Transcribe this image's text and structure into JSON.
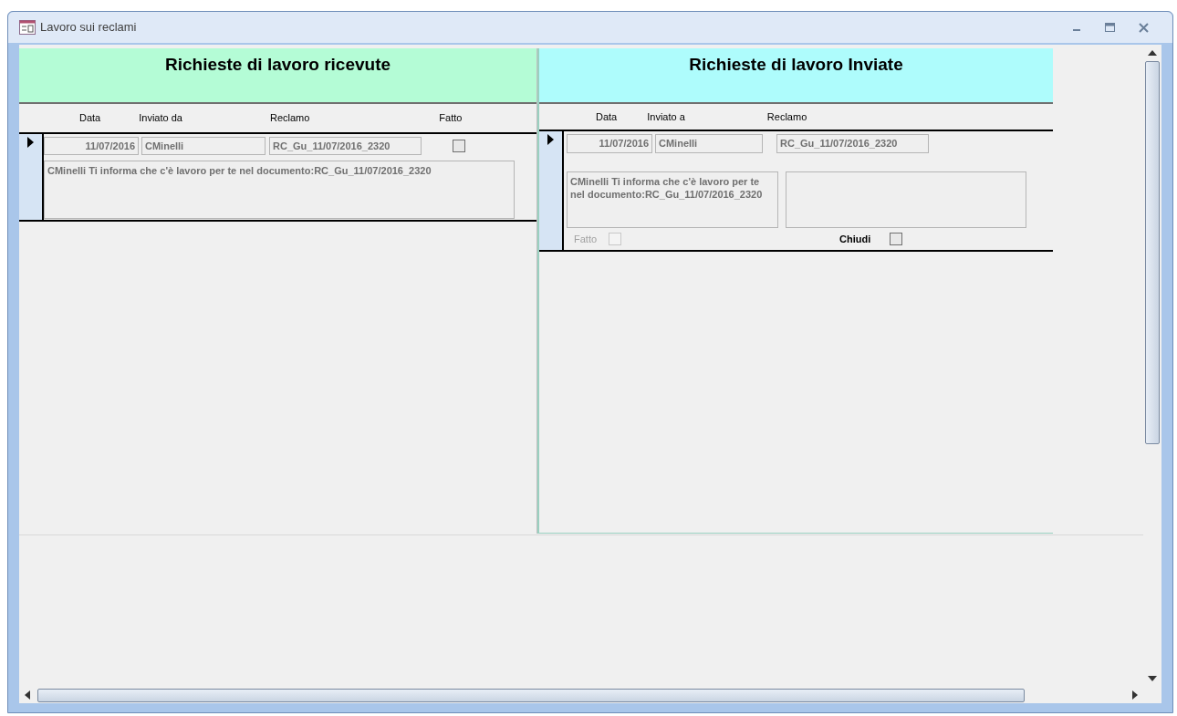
{
  "window": {
    "title": "Lavoro sui reclami"
  },
  "panels": [
    {
      "kind": "received",
      "title": "Richieste di lavoro ricevute",
      "color": "#b4fcd6",
      "columns": [
        "Data",
        "Inviato da",
        "Reclamo",
        "Fatto"
      ],
      "record": {
        "selected": true,
        "date": "11/07/2016",
        "user": "CMinelli",
        "complaint": "RC_Gu_11/07/2016_2320",
        "message": "CMinelli Ti informa che c'è lavoro per te nel documento:RC_Gu_11/07/2016_2320",
        "done": {
          "checked": false,
          "disabled": false
        }
      }
    },
    {
      "kind": "sent",
      "title": "Richieste di lavoro Inviate",
      "color": "#aefcfc",
      "columns": [
        "Data",
        "Inviato a",
        "Reclamo"
      ],
      "record": {
        "selected": true,
        "date": "11/07/2016",
        "user": "CMinelli",
        "complaint": "RC_Gu_11/07/2016_2320",
        "message": "CMinelli Ti informa che c'è lavoro per te nel documento:RC_Gu_11/07/2016_2320",
        "done": {
          "label": "Fatto",
          "checked": false,
          "disabled": true
        },
        "close": {
          "label": "Chiudi",
          "checked": false,
          "disabled": false
        }
      }
    }
  ]
}
